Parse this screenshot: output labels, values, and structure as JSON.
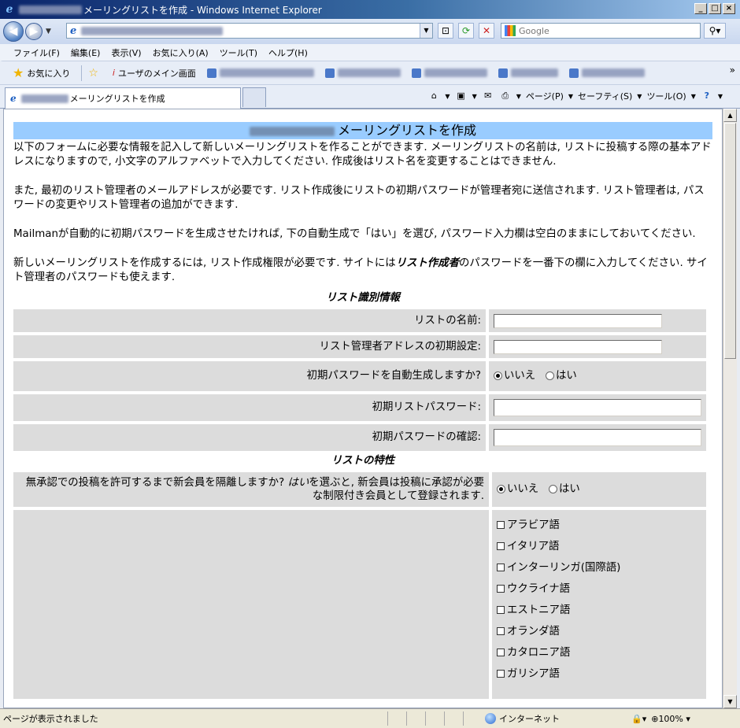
{
  "window": {
    "title_suffix": "メーリングリストを作成 - Windows Internet Explorer"
  },
  "toolbar": {
    "search_placeholder": "Google"
  },
  "menu": [
    "ファイル(F)",
    "編集(E)",
    "表示(V)",
    "お気に入り(A)",
    "ツール(T)",
    "ヘルプ(H)"
  ],
  "favorites": {
    "label": "お気に入り",
    "links": [
      "ユーザのメイン画面"
    ]
  },
  "tab": {
    "title_suffix": "メーリングリストを作成"
  },
  "commands": {
    "page": "ページ(P)",
    "safety": "セーフティ(S)",
    "tools": "ツール(O)"
  },
  "page": {
    "heading_suffix": "メーリングリストを作成",
    "paragraphs": [
      "以下のフォームに必要な情報を記入して新しいメーリングリストを作ることができます. メーリングリストの名前は, リストに投稿する際の基本アドレスになりますので, 小文字のアルファベットで入力してください. 作成後はリスト名を変更することはできません.",
      "また, 最初のリスト管理者のメールアドレスが必要です. リスト作成後にリストの初期パスワードが管理者宛に送信されます. リスト管理者は, パスワードの変更やリスト管理者の追加ができます.",
      "Mailmanが自動的に初期パスワードを生成させたければ, 下の自動生成で「はい」を選び, パスワード入力欄は空白のままにしておいてください."
    ],
    "p4_before": "新しいメーリングリストを作成するには, リスト作成権限が必要です. サイトには",
    "p4_em": "リスト作成者",
    "p4_after": "のパスワードを一番下の欄に入力してください. サイト管理者のパスワードも使えます.",
    "section1": "リスト識別情報",
    "section2": "リストの特性",
    "fields": {
      "list_name": "リストの名前:",
      "owner_address": "リスト管理者アドレスの初期設定:",
      "autogen": "初期パスワードを自動生成しますか?",
      "password": "初期リストパスワード:",
      "confirm": "初期パスワードの確認:",
      "moderate_before": "無承認での投稿を許可するまで新会員を隔離しますか? ",
      "moderate_em": "はい",
      "moderate_after": "を選ぶと, 新会員は投稿に承認が必要な制限付き会員として登録されます."
    },
    "radio": {
      "no": "いいえ",
      "yes": "はい",
      "autogen_selected": "no",
      "moderate_selected": "no"
    },
    "languages": [
      "アラビア語",
      "イタリア語",
      "インターリンガ(国際語)",
      "ウクライナ語",
      "エストニア語",
      "オランダ語",
      "カタロニア語",
      "ガリシア語"
    ]
  },
  "status": {
    "text": "ページが表示されました",
    "zone": "インターネット",
    "zoom": "100%"
  }
}
